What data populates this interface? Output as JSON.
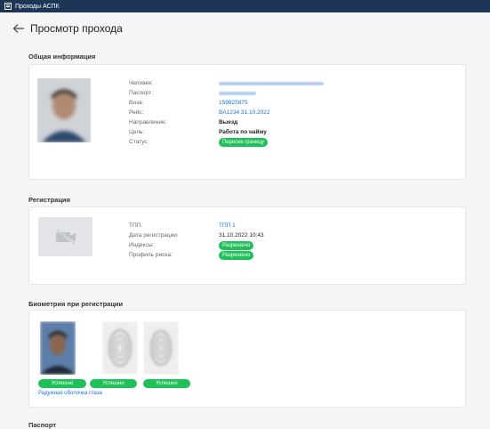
{
  "window": {
    "title": "Проходы АСПК"
  },
  "header": {
    "title": "Просмотр прохода"
  },
  "general": {
    "section_title": "Общая информация",
    "fields": [
      {
        "label": "Человек:",
        "value": ""
      },
      {
        "label": "Паспорт:",
        "value": ""
      },
      {
        "label": "Виза:",
        "value": "159825875"
      },
      {
        "label": "Рейс:",
        "value": "BA1234 31.10.2022"
      },
      {
        "label": "Направление:",
        "value": "Выезд"
      },
      {
        "label": "Цель:",
        "value": "Работа по найму"
      },
      {
        "label": "Статус:",
        "value": "Пересек границу"
      }
    ]
  },
  "registration": {
    "section_title": "Регистрация",
    "fields": [
      {
        "label": "ТПП:",
        "value": "ТПП 1"
      },
      {
        "label": "Дата регистрации:",
        "value": "31.10.2022 10:43"
      },
      {
        "label": "Индексы:",
        "value": "Разрешено"
      },
      {
        "label": "Профиль риска:",
        "value": "Разрешено"
      }
    ]
  },
  "biometrics": {
    "section_title": "Биометрия при регистрации",
    "statuses": [
      "Успешно",
      "Успешно",
      "Успешно"
    ],
    "iris_link": "Радужная оболочка глаза"
  },
  "passport": {
    "section_title": "Паспорт"
  },
  "colors": {
    "accent": "#1a73e8",
    "success": "#1fbf5a",
    "titlebar": "#1d3557"
  }
}
